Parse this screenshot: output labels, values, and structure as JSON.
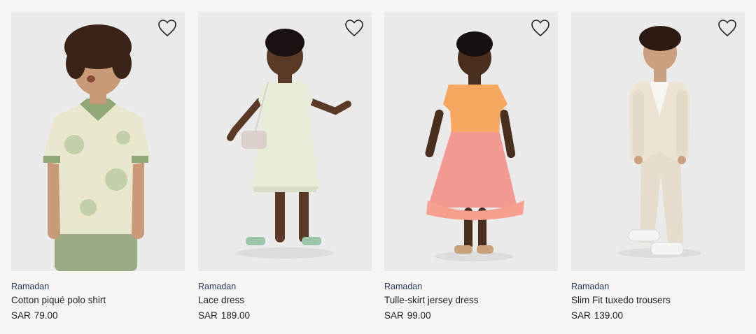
{
  "products": [
    {
      "tag": "Ramadan",
      "name": "Cotton piqué polo shirt",
      "currency": "SAR",
      "price": "79.00",
      "colors": {
        "garment": "#e8e6cc",
        "accent": "#8fa876",
        "bottom": "#9aab84",
        "skin": "#c89a78",
        "hair": "#3a2418"
      }
    },
    {
      "tag": "Ramadan",
      "name": "Lace dress",
      "currency": "SAR",
      "price": "189.00",
      "colors": {
        "garment": "#e7ecd6",
        "accent": "#d9d0cc",
        "bottom": "#e7ecd6",
        "skin": "#5a3a26",
        "hair": "#1a1210"
      }
    },
    {
      "tag": "Ramadan",
      "name": "Tulle-skirt jersey dress",
      "currency": "SAR",
      "price": "99.00",
      "colors": {
        "garment": "#f7a860",
        "accent": "#f58f88",
        "bottom": "#f58f88",
        "skin": "#4a2e1e",
        "hair": "#161010"
      }
    },
    {
      "tag": "Ramadan",
      "name": "Slim Fit tuxedo trousers",
      "currency": "SAR",
      "price": "139.00",
      "colors": {
        "garment": "#ebe2d2",
        "accent": "#e4dac8",
        "bottom": "#e6dccb",
        "skin": "#caa080",
        "hair": "#2a1a12"
      }
    }
  ]
}
